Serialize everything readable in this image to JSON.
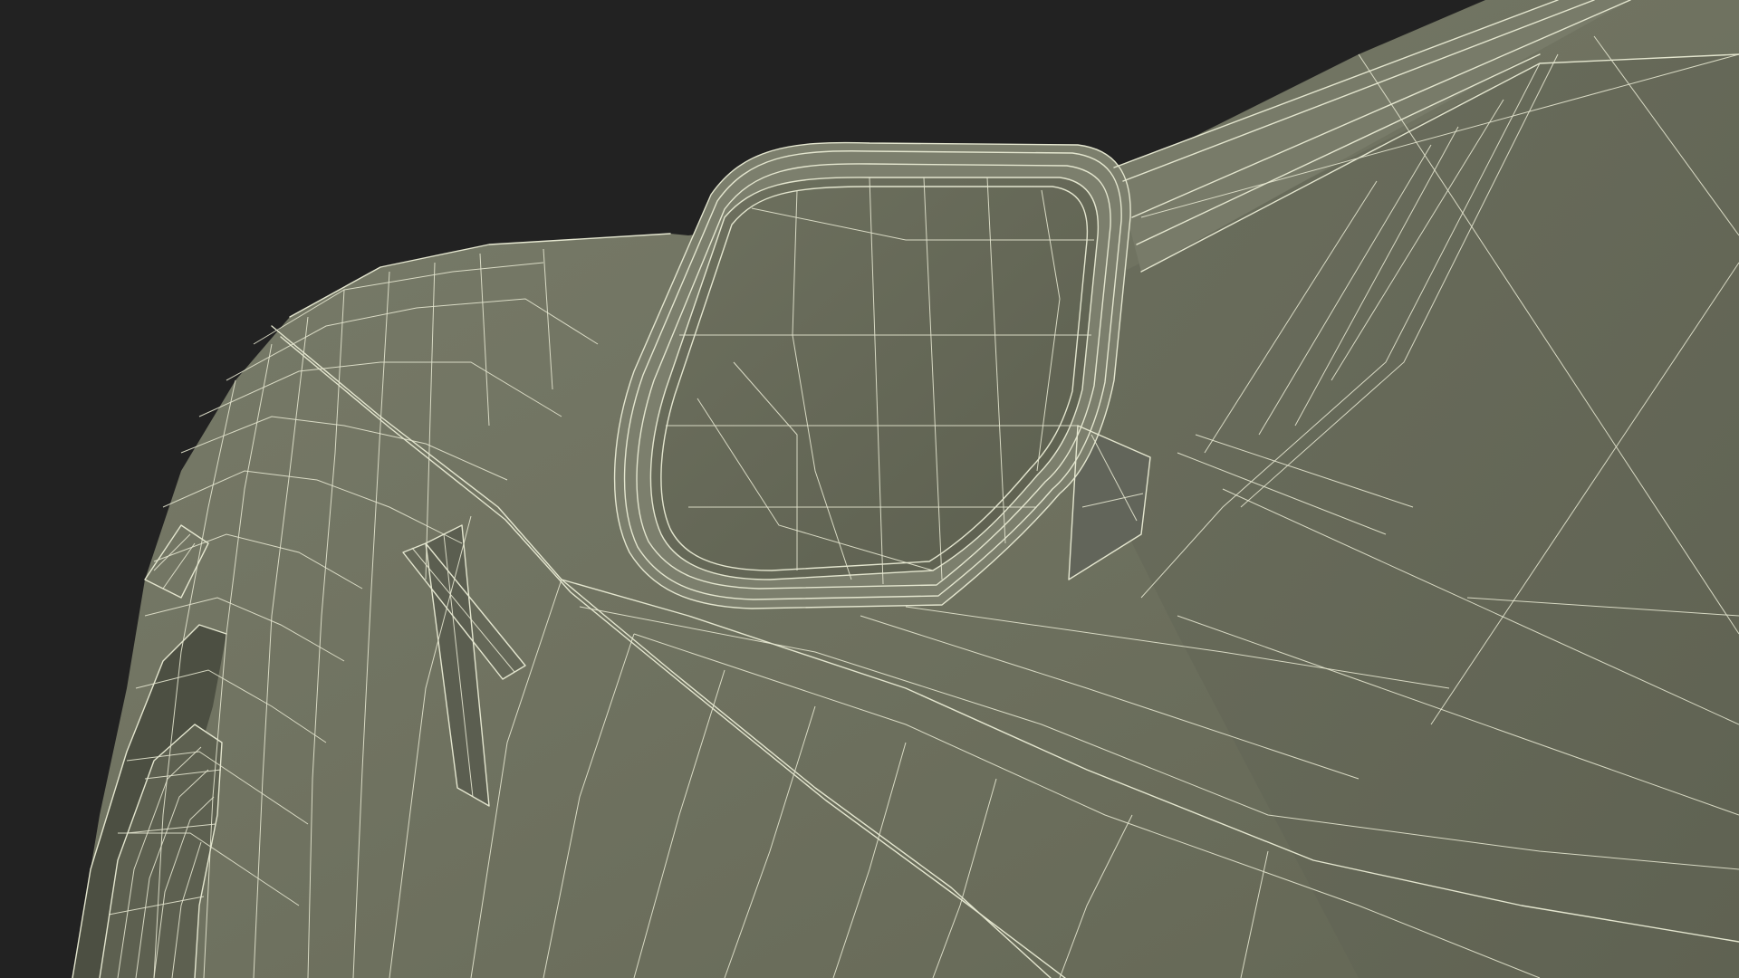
{
  "scene": {
    "background_color": "#222222",
    "surface_color": "#6f7260",
    "surface_shadow_color": "#5a5d4e",
    "surface_highlight_color": "#7f8270",
    "wireframe_color": "#e4e6cf"
  }
}
